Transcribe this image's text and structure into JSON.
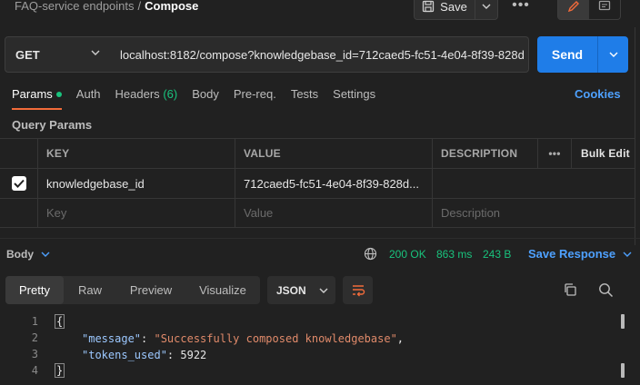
{
  "breadcrumb": {
    "parent": "FAQ-service endpoints",
    "separator": "/",
    "current": "Compose"
  },
  "toolbar": {
    "save_label": "Save",
    "more": "•••"
  },
  "request": {
    "method": "GET",
    "url": "localhost:8182/compose?knowledgebase_id=712caed5-fc51-4e04-8f39-828d",
    "send_label": "Send"
  },
  "tabs": [
    {
      "label": "Params",
      "dot": true
    },
    {
      "label": "Auth"
    },
    {
      "label": "Headers",
      "count": "(6)"
    },
    {
      "label": "Body"
    },
    {
      "label": "Pre-req."
    },
    {
      "label": "Tests"
    },
    {
      "label": "Settings"
    }
  ],
  "cookies_label": "Cookies",
  "query_params": {
    "title": "Query Params",
    "headers": {
      "key": "KEY",
      "value": "VALUE",
      "description": "DESCRIPTION",
      "more": "•••",
      "bulk_edit": "Bulk Edit"
    },
    "rows": [
      {
        "checked": true,
        "key": "knowledgebase_id",
        "value": "712caed5-fc51-4e04-8f39-828d...",
        "description": ""
      }
    ],
    "placeholders": {
      "key": "Key",
      "value": "Value",
      "description": "Description"
    }
  },
  "response": {
    "body_label": "Body",
    "status": "200 OK",
    "time": "863 ms",
    "size": "243 B",
    "save_label": "Save Response",
    "view_tabs": [
      "Pretty",
      "Raw",
      "Preview",
      "Visualize"
    ],
    "active_view": "Pretty",
    "format": "JSON",
    "lines": {
      "n1": "1",
      "n2": "2",
      "n3": "3",
      "n4": "4",
      "open": "{",
      "close": "}",
      "key1": "\"message\"",
      "val1": "\"Successfully composed knowledgebase\"",
      "key2": "\"tokens_used\"",
      "val2": "5922",
      "colon": ": ",
      "comma": ","
    }
  },
  "colors": {
    "accent": "#1f7de8",
    "success": "#19c37d",
    "tab_underline": "#f26b3a",
    "link": "#4ea1ff"
  }
}
